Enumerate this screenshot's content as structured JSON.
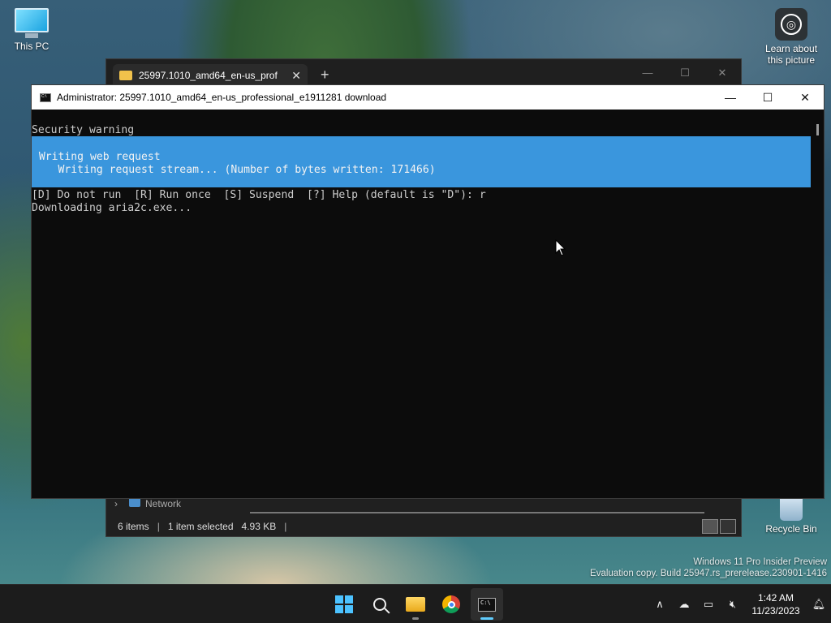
{
  "desktop": {
    "icons": {
      "this_pc": "This PC",
      "learn": "Learn about\nthis picture",
      "recycle_bin": "Recycle Bin"
    },
    "watermark": {
      "line1": "Windows 11 Pro Insider Preview",
      "line2": "Evaluation copy. Build 25947.rs_prerelease.230901-1416"
    }
  },
  "explorer": {
    "tab_label": "25997.1010_amd64_en-us_prof",
    "nav_network": "Network",
    "status": {
      "items": "6 items",
      "selected": "1 item selected",
      "size": "4.93 KB"
    }
  },
  "console": {
    "title": "Administrator:  25997.1010_amd64_en-us_professional_e1911281 download",
    "lines": {
      "security_warning": "Security warning",
      "progress_activity": " Writing web request",
      "progress_status": "    Writing request stream... (Number of bytes written: 171466)",
      "prompt": "[D] Do not run  [R] Run once  [S] Suspend  [?] Help (default is \"D\"): r",
      "downloading": "Downloading aria2c.exe..."
    },
    "progress_color": "#3a96dd"
  },
  "taskbar": {
    "apps": [
      "start-icon",
      "search-icon",
      "file-explorer-icon",
      "chrome-icon",
      "terminal-icon"
    ],
    "clock": {
      "time": "1:42 AM",
      "date": "11/23/2023"
    }
  }
}
